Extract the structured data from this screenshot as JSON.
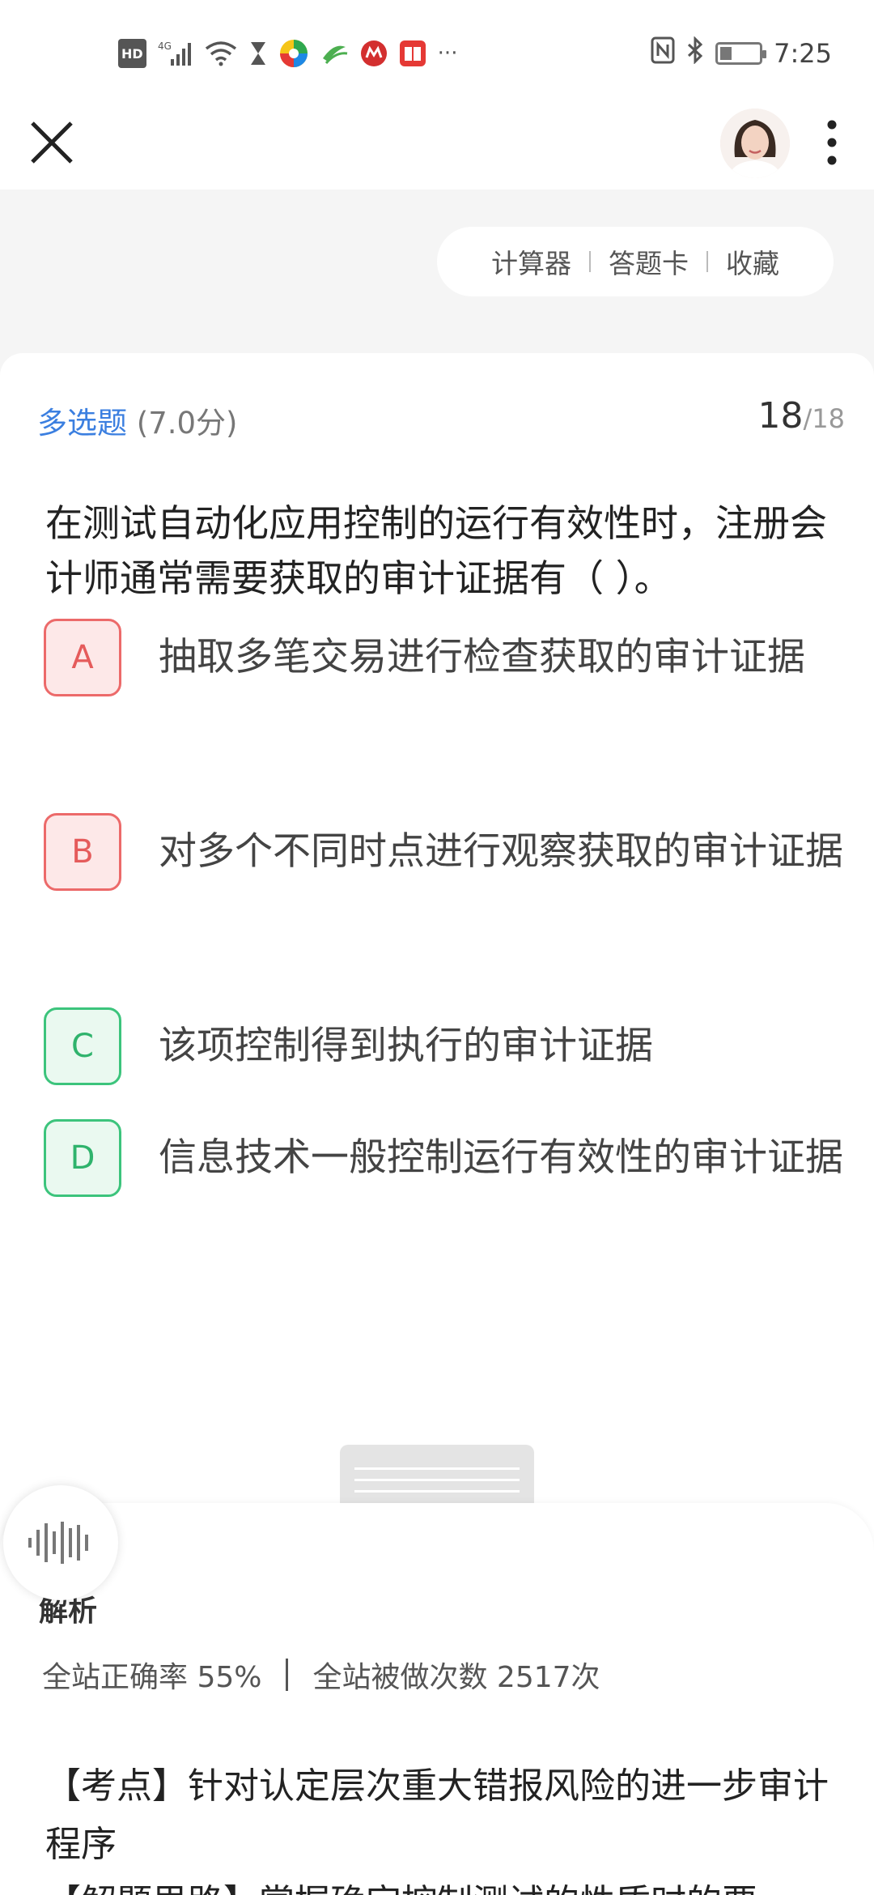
{
  "status_bar": {
    "network": "4G",
    "time": "7:25",
    "icons": [
      "hd-icon",
      "signal-icon",
      "wifi-icon",
      "hourglass-icon",
      "app-icon-1",
      "app-icon-2",
      "app-icon-3",
      "app-icon-4",
      "more-dots-icon",
      "nfc-icon",
      "bluetooth-icon",
      "battery-icon"
    ],
    "hd_label": "HD",
    "more": "···"
  },
  "header": {
    "close_icon": "close-icon",
    "menu_icon": "more-vertical-icon"
  },
  "tools": {
    "calculator": "计算器",
    "answer_card": "答题卡",
    "favorite": "收藏"
  },
  "question": {
    "type": "多选题",
    "score": "(7.0分)",
    "current": "18",
    "total": "/18",
    "stem": "在测试自动化应用控制的运行有效性时，注册会计师通常需要获取的审计证据有（   ）。",
    "options": [
      {
        "letter": "A",
        "text": "抽取多笔交易进行检查获取的审计证据",
        "state": "wrong"
      },
      {
        "letter": "B",
        "text": "对多个不同时点进行观察获取的审计证据",
        "state": "wrong"
      },
      {
        "letter": "C",
        "text": "该项控制得到执行的审计证据",
        "state": "correct"
      },
      {
        "letter": "D",
        "text": "信息技术一般控制运行有效性的审计证据",
        "state": "correct"
      }
    ]
  },
  "analysis": {
    "title": "解析",
    "accuracy_label": "全站正确率 55%",
    "attempts_label": "全站被做次数 2517次",
    "text": "【考点】针对认定层次重大错报风险的进一步审计程序",
    "text2": "【解题思路】掌握确定控制测试的性质时的要"
  },
  "colors": {
    "accent_blue": "#3b7fe0",
    "wrong_red": "#ec6a6a",
    "correct_green": "#3cc47c"
  }
}
